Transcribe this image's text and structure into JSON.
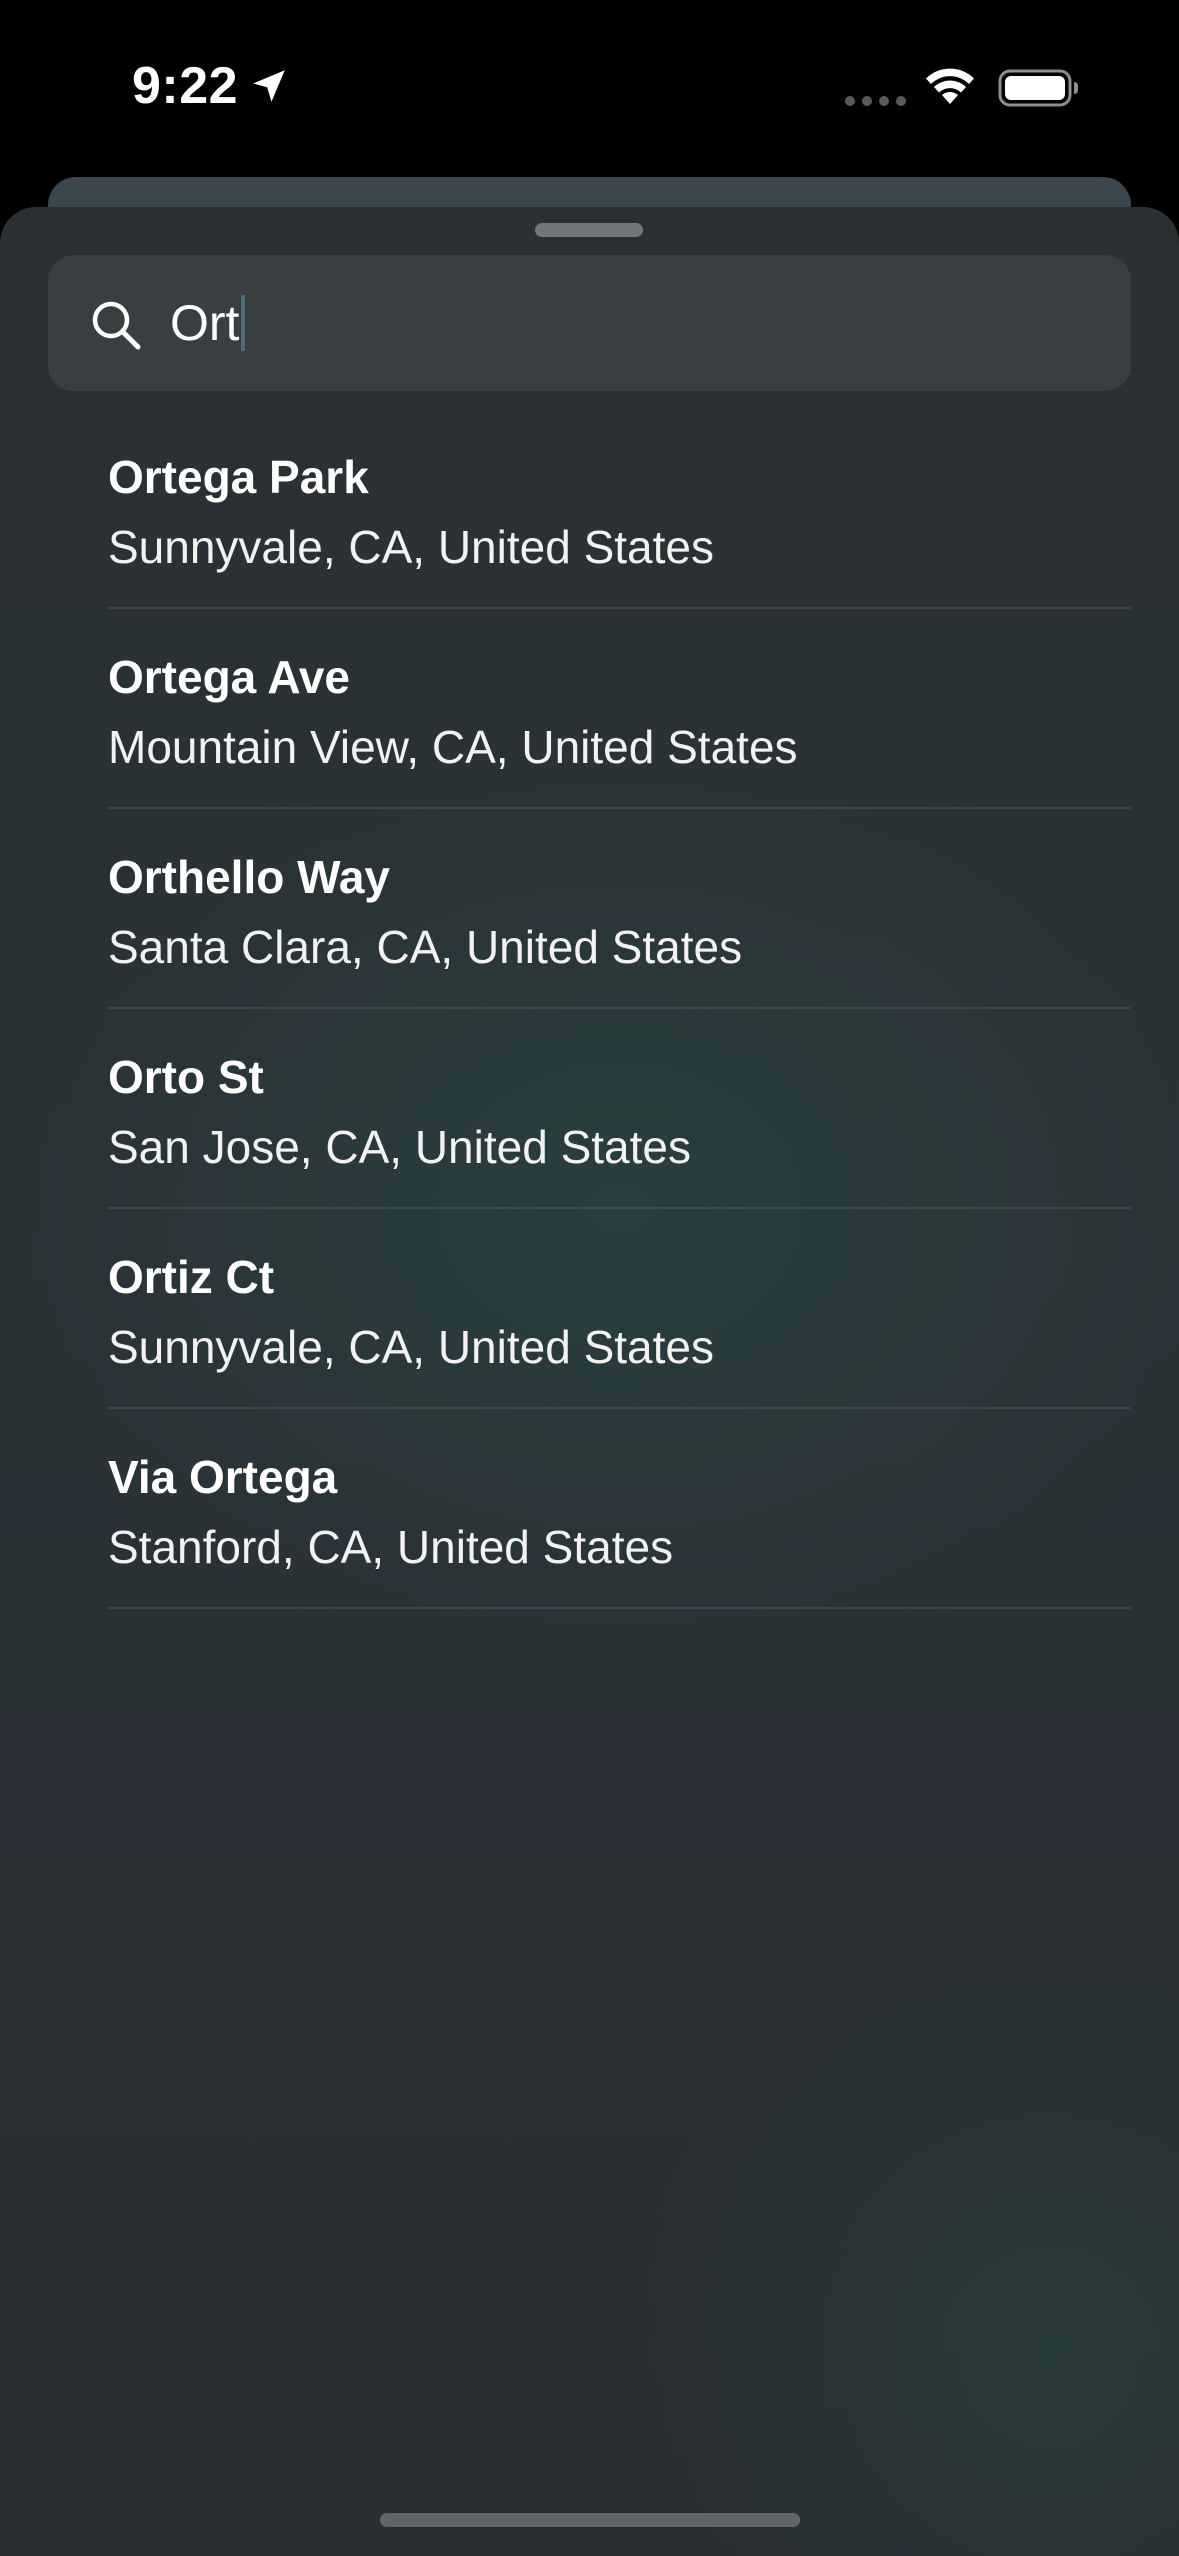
{
  "status_bar": {
    "time": "9:22",
    "location_icon": "location-arrow-icon",
    "signal_icon": "cellular-dots-icon",
    "wifi_icon": "wifi-icon",
    "battery_icon": "battery-icon"
  },
  "search": {
    "icon": "search-icon",
    "value": "Ort",
    "placeholder": ""
  },
  "results": [
    {
      "title": "Ortega Park",
      "subtitle": "Sunnyvale, CA, United States"
    },
    {
      "title": "Ortega Ave",
      "subtitle": "Mountain View, CA, United States"
    },
    {
      "title": "Orthello Way",
      "subtitle": "Santa Clara, CA, United States"
    },
    {
      "title": "Orto St",
      "subtitle": "San Jose, CA, United States"
    },
    {
      "title": "Ortiz Ct",
      "subtitle": "Sunnyvale, CA, United States"
    },
    {
      "title": "Via Ortega",
      "subtitle": "Stanford, CA, United States"
    }
  ],
  "colors": {
    "background": "#000000",
    "sheet": "#2b3033",
    "text_primary": "#ffffff",
    "caret": "#4f6d78"
  }
}
